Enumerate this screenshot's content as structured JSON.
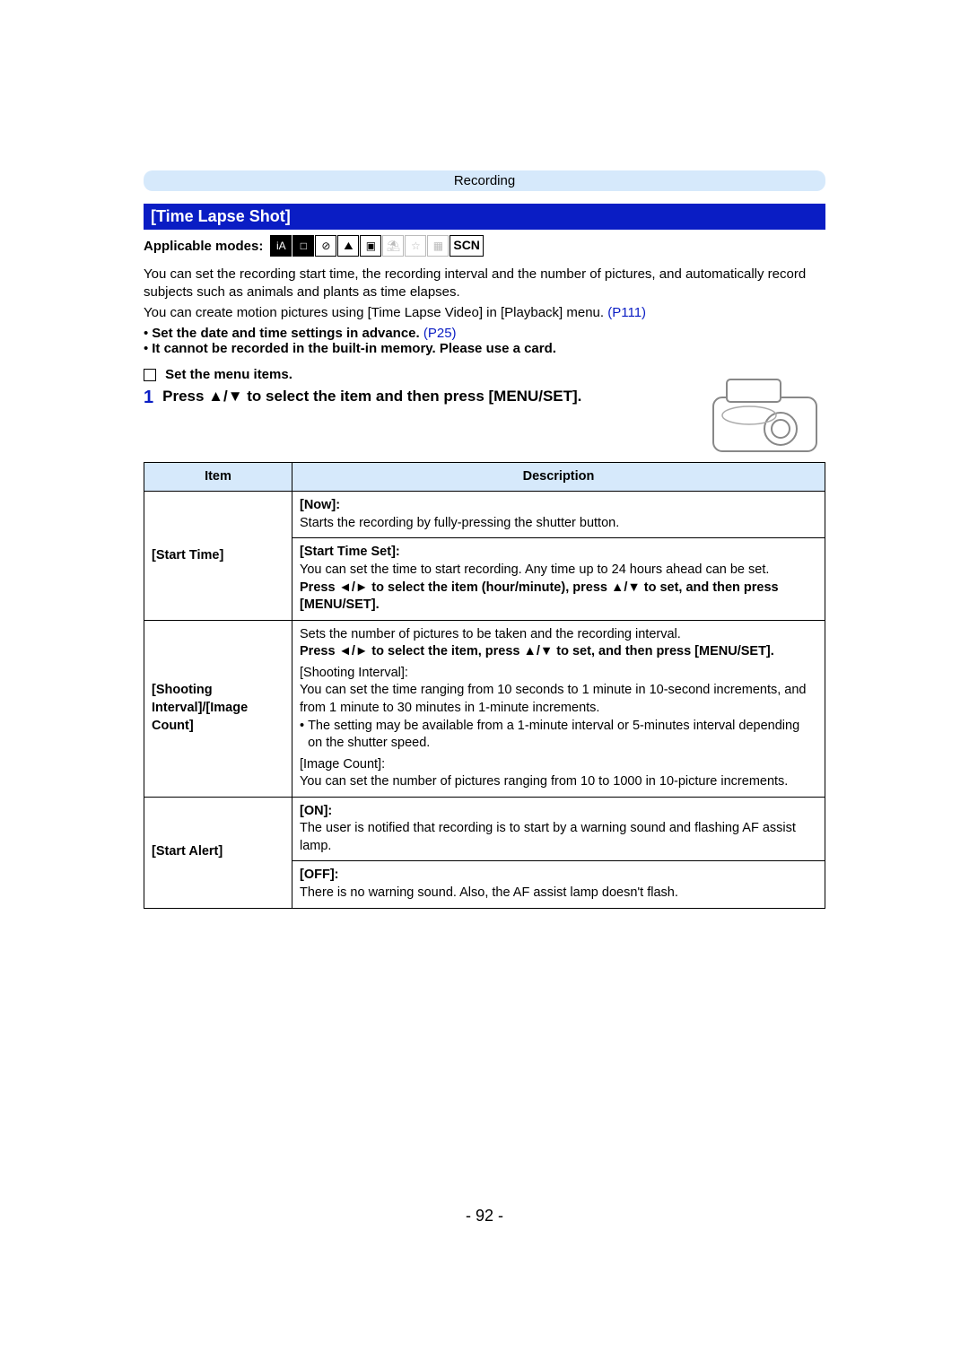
{
  "header": {
    "category": "Recording"
  },
  "title": "[Time Lapse Shot]",
  "modes": {
    "label": "Applicable modes:",
    "icons": [
      "iA",
      "□",
      "⊘",
      "⛰",
      "▣",
      "⛱",
      "☆",
      "▦"
    ],
    "scn": "SCN"
  },
  "intro": {
    "p1": "You can set the recording start time, the recording interval and the number of pictures, and automatically record subjects such as animals and plants as time elapses.",
    "p2_a": "You can create motion pictures using [Time Lapse Video] in [Playback] menu. ",
    "p2_link": "(P111)",
    "b1_a": "Set the date and time settings in advance.",
    "b1_link": " (P25)",
    "b2": "It cannot be recorded in the built-in memory. Please use a card."
  },
  "subheading": "Set the menu items.",
  "step": {
    "num": "1",
    "text": "Press ▲/▼ to select the item and then press [MENU/SET]."
  },
  "table": {
    "headers": [
      "Item",
      "Description"
    ],
    "rows": [
      {
        "left": "[Start Time]",
        "cells": [
          {
            "h": "[Now]:",
            "t": "Starts the recording by fully-pressing the shutter button."
          },
          {
            "h": "[Start Time Set]:",
            "t": "You can set the time to start recording. Any time up to 24 hours ahead can be set.",
            "extra": "Press ◄/► to select the item (hour/minute), press ▲/▼ to set, and then press [MENU/SET]."
          }
        ]
      },
      {
        "left": "[Shooting Interval]/[Image Count]",
        "cells": [
          {
            "t1": "Sets the number of pictures to be taken and the recording interval.",
            "t2": "Press ◄/► to select the item, press ▲/▼ to set, and then press [MENU/SET].",
            "t3_h": "[Shooting Interval]:",
            "t3": "You can set the time ranging from 10 seconds to 1 minute in 10-second increments, and from 1 minute to 30 minutes in 1-minute increments.",
            "t3_note": "The setting may be available from a 1-minute interval or 5-minutes interval depending on the shutter speed.",
            "t4_h": "[Image Count]:",
            "t4": "You can set the number of pictures ranging from 10 to 1000 in 10-picture increments."
          }
        ]
      },
      {
        "left": "[Start Alert]",
        "cells": [
          {
            "h": "[ON]:",
            "t": "The user is notified that recording is to start by a warning sound and flashing AF assist lamp."
          },
          {
            "h": "[OFF]:",
            "t": "There is no warning sound. Also, the AF assist lamp doesn't flash."
          }
        ]
      }
    ]
  },
  "page_number": "- 92 -"
}
